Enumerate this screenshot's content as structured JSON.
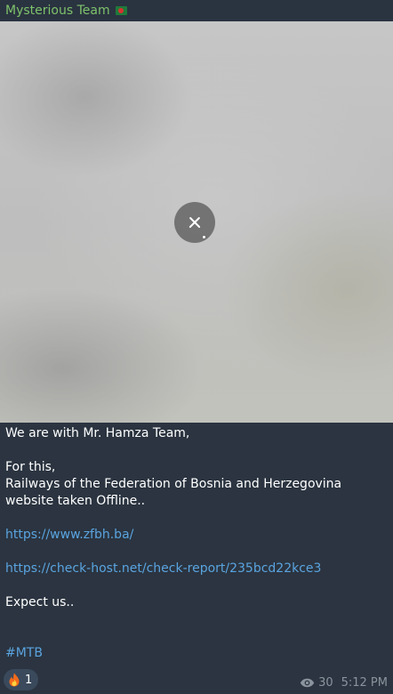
{
  "header": {
    "channel_name": "Mysterious Team",
    "flag_icon": "bangladesh-flag-icon",
    "name_color": "#7ec26b"
  },
  "media": {
    "state": "downloading",
    "cancel_icon": "close-icon"
  },
  "message": {
    "lines": [
      {
        "text": "We are with Mr. Hamza Team,",
        "type": "text"
      },
      {
        "text": "",
        "type": "blank"
      },
      {
        "text": "For this,",
        "type": "text"
      },
      {
        "text": "Railways of the Federation of Bosnia and Herzegovina website taken Offline..",
        "type": "text"
      },
      {
        "text": "",
        "type": "blank"
      },
      {
        "text": "https://www.zfbh.ba/",
        "type": "link"
      },
      {
        "text": "",
        "type": "blank"
      },
      {
        "text": "https://check-host.net/check-report/235bcd22kce3",
        "type": "link"
      },
      {
        "text": "",
        "type": "blank"
      },
      {
        "text": "Expect us..",
        "type": "text"
      },
      {
        "text": "",
        "type": "blank"
      },
      {
        "text": "",
        "type": "blank"
      },
      {
        "text": "#MTB",
        "type": "link"
      }
    ],
    "link_color": "#5aa4e0"
  },
  "reaction": {
    "icon": "fire-icon",
    "count": "1"
  },
  "footer": {
    "views_icon": "eye-icon",
    "views": "30",
    "time": "5:12 PM"
  }
}
